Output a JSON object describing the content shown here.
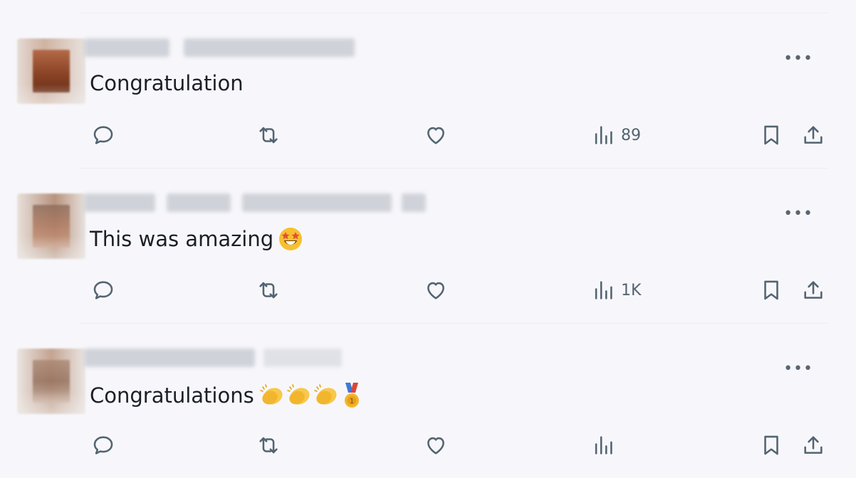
{
  "posts": [
    {
      "text": "Congratulation",
      "views": "89"
    },
    {
      "text": "This was amazing",
      "views": "1K"
    },
    {
      "text": "Congratulations",
      "views": ""
    }
  ],
  "icons": {
    "more": "more-icon",
    "reply": "reply-icon",
    "repost": "repost-icon",
    "like": "like-icon",
    "views": "views-icon",
    "bookmark": "bookmark-icon",
    "share": "share-icon"
  },
  "colors": {
    "background": "#f7f7fb",
    "icon": "#536471",
    "text": "#0f1419"
  }
}
